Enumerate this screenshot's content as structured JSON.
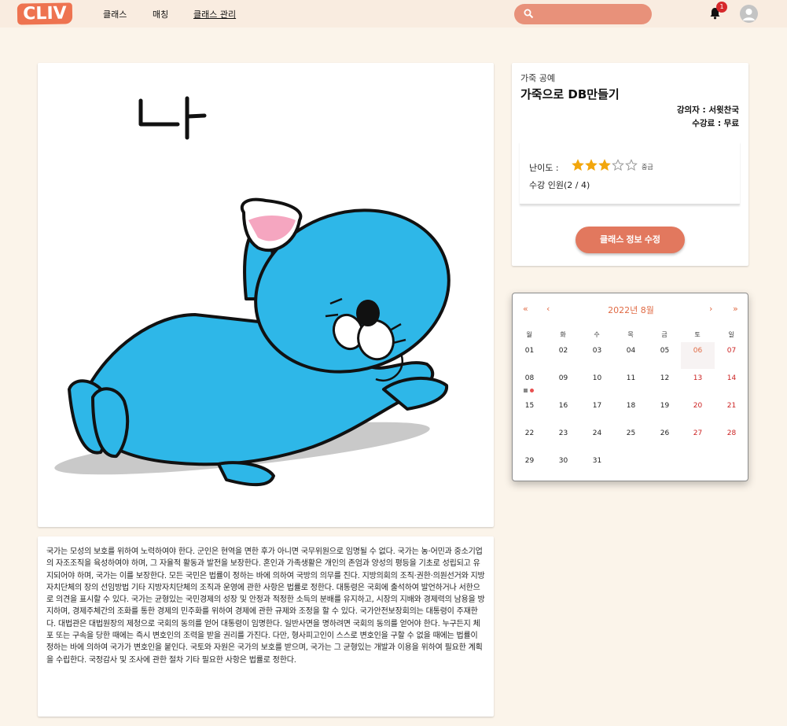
{
  "header": {
    "logo": "CLIV",
    "nav": [
      "클래스",
      "매칭",
      "클래스 관리"
    ],
    "search_placeholder": "",
    "notification_count": "1"
  },
  "image_card": {
    "handwritten_text": "나"
  },
  "description": "국가는 모성의 보호를 위하여 노력하여야 한다. 군인은 현역을 면한 후가 아니면 국무위원으로 임명될 수 없다. 국가는 농·어민과 중소기업의 자조조직을 육성하여야 하며, 그 자율적 활동과 발전을 보장한다. 혼인과 가족생활은 개인의 존엄과 양성의 평등을 기초로 성립되고 유지되어야 하며, 국가는 이를 보장한다. 모든 국민은 법률이 정하는 바에 의하여 국방의 의무를 진다. 지방의회의 조직·권한·의원선거와 지방자치단체의 장의 선임방법 기타 지방자치단체의 조직과 운영에 관한 사항은 법률로 정한다. 대통령은 국회에 출석하여 발언하거나 서한으로 의견을 표시할 수 있다. 국가는 균형있는 국민경제의 성장 및 안정과 적정한 소득의 분배를 유지하고, 시장의 지배와 경제력의 남용을 방지하며, 경제주체간의 조화를 통한 경제의 민주화를 위하여 경제에 관한 규제와 조정을 할 수 있다. 국가안전보장회의는 대통령이 주재한다. 대법관은 대법원장의 제청으로 국회의 동의를 얻어 대통령이 임명한다. 일반사면을 명하려면 국회의 동의를 얻어야 한다. 누구든지 체포 또는 구속을 당한 때에는 즉시 변호인의 조력을 받을 권리를 가진다. 다만, 형사피고인이 스스로 변호인을 구할 수 없을 때에는 법률이 정하는 바에 의하여 국가가 변호인을 붙인다. 국토와 자원은 국가의 보호를 받으며, 국가는 그 균형있는 개발과 이용을 위하여 필요한 계획을 수립한다. 국정감사 및 조사에 관한 절차 기타 필요한 사항은 법률로 정한다.",
  "info": {
    "category": "가죽 공예",
    "title": "가죽으로 DB만들기",
    "teacher": "강의자 : 서윗찬국",
    "fee": "수강료 : 무료",
    "difficulty_label": "난이도 :",
    "difficulty_rating": 3,
    "difficulty_max": 5,
    "difficulty_text": "중급",
    "enrollment": "수강 인원(2 / 4)",
    "edit_button": "클래스 정보 수정"
  },
  "calendar": {
    "title": "2022년 8월",
    "prev_year": "«",
    "prev_month": "‹",
    "next_month": "›",
    "next_year": "»",
    "weekdays": [
      "월",
      "화",
      "수",
      "목",
      "금",
      "토",
      "일"
    ],
    "weeks": [
      [
        "01",
        "02",
        "03",
        "04",
        "05",
        "06",
        "07"
      ],
      [
        "08",
        "09",
        "10",
        "11",
        "12",
        "13",
        "14"
      ],
      [
        "15",
        "16",
        "17",
        "18",
        "19",
        "20",
        "21"
      ],
      [
        "22",
        "23",
        "24",
        "25",
        "26",
        "27",
        "28"
      ],
      [
        "29",
        "30",
        "31",
        "",
        "",
        "",
        ""
      ]
    ],
    "today": "06",
    "event_day": "08",
    "accent": "#e06b45"
  }
}
